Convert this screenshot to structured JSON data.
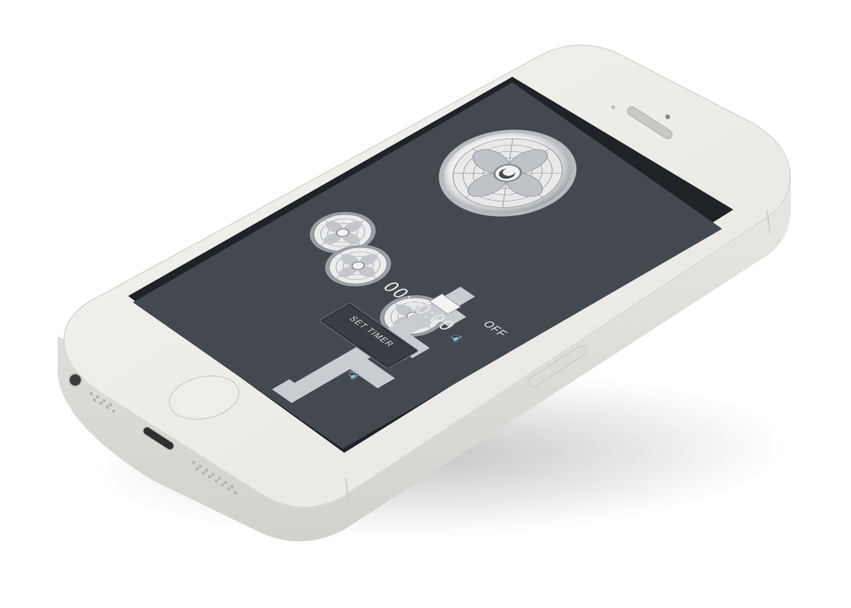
{
  "app": {
    "speed": {
      "off_label": "OFF",
      "levels": [
        "speaker-low-icon",
        "speaker-medium-icon",
        "speaker-high-icon"
      ]
    },
    "timer": {
      "display": "00:00:00",
      "set_label": "SET TIMER"
    },
    "fans": {
      "main": "fan-large-icon",
      "presets": [
        "fan-preset-1-icon",
        "fan-preset-2-icon",
        "fan-preset-3-icon"
      ]
    }
  },
  "colors": {
    "phone_body": "#ecebe7",
    "screen_bg": "#444950",
    "slider_track": "#c9ccd1",
    "text": "#e6e6e6"
  }
}
